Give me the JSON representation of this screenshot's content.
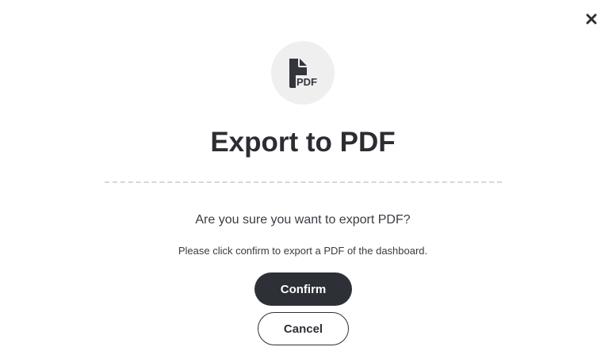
{
  "dialog": {
    "title": "Export to PDF",
    "question": "Are you sure you want to export PDF?",
    "description": "Please click confirm to export a PDF of the dashboard.",
    "confirm_label": "Confirm",
    "cancel_label": "Cancel",
    "icon": "pdf-file-icon",
    "icon_text": "PDF",
    "close_icon": "close-icon"
  },
  "colors": {
    "primary_dark": "#2e3038",
    "icon_bg": "#efefef",
    "divider": "#d6d6d6",
    "background": "#ffffff"
  }
}
